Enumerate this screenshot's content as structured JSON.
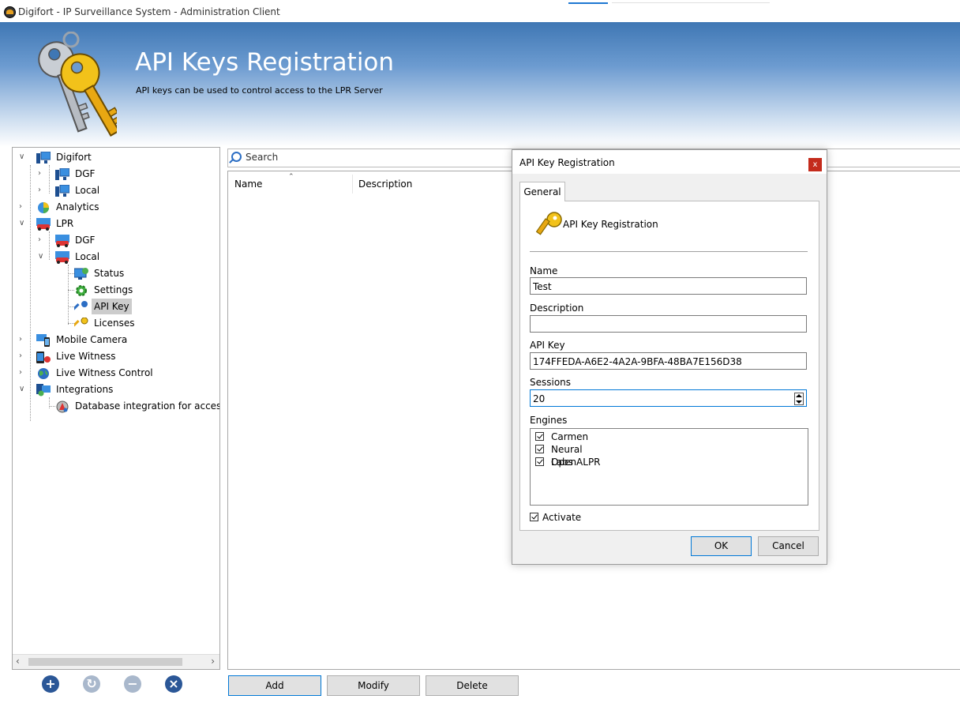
{
  "window": {
    "title": "Digifort - IP Surveillance System - Administration Client"
  },
  "header": {
    "title": "API Keys Registration",
    "subtitle": "API keys can be used to control access to the LPR Server"
  },
  "tree": {
    "items": [
      {
        "label": "Digifort",
        "icon": "server-icon"
      },
      {
        "label": "DGF",
        "icon": "server-icon"
      },
      {
        "label": "Local",
        "icon": "server-icon"
      },
      {
        "label": "Analytics",
        "icon": "analytics-icon"
      },
      {
        "label": "LPR",
        "icon": "car-icon"
      },
      {
        "label": "DGF",
        "icon": "car-icon"
      },
      {
        "label": "Local",
        "icon": "car-icon"
      },
      {
        "label": "Status",
        "icon": "monitor-icon"
      },
      {
        "label": "Settings",
        "icon": "gear-icon"
      },
      {
        "label": "API Key",
        "icon": "key-icon"
      },
      {
        "label": "Licenses",
        "icon": "license-key-icon"
      },
      {
        "label": "Mobile Camera",
        "icon": "mobile-camera-icon"
      },
      {
        "label": "Live Witness",
        "icon": "live-witness-icon"
      },
      {
        "label": "Live Witness Control",
        "icon": "globe-icon"
      },
      {
        "label": "Integrations",
        "icon": "integrations-icon"
      },
      {
        "label": "Database integration for access c",
        "icon": "database-integration-icon"
      }
    ]
  },
  "search": {
    "placeholder": "Search"
  },
  "list": {
    "columns": [
      "Name",
      "Description"
    ]
  },
  "actions": {
    "add": "Add",
    "modify": "Modify",
    "delete": "Delete"
  },
  "dialog": {
    "title": "API Key Registration",
    "close_label": "x",
    "tab": "General",
    "heading": "API Key Registration",
    "name_label": "Name",
    "name_value": "Test",
    "description_label": "Description",
    "description_value": "",
    "apikey_label": "API Key",
    "apikey_value": "174FFEDA-A6E2-4A2A-9BFA-48BA7E156D38",
    "sessions_label": "Sessions",
    "sessions_value": "20",
    "engines_label": "Engines",
    "engines": [
      {
        "label": "Carmen",
        "checked": true
      },
      {
        "label": "Neural Labs",
        "checked": true
      },
      {
        "label": "OpenALPR",
        "checked": true
      }
    ],
    "activate_label": "Activate",
    "ok": "OK",
    "cancel": "Cancel"
  },
  "colors": {
    "header_blue": "#3f77b4",
    "accent": "#0078d7",
    "close_red": "#c42b1c",
    "tree_button_blue": "#2b5797"
  }
}
